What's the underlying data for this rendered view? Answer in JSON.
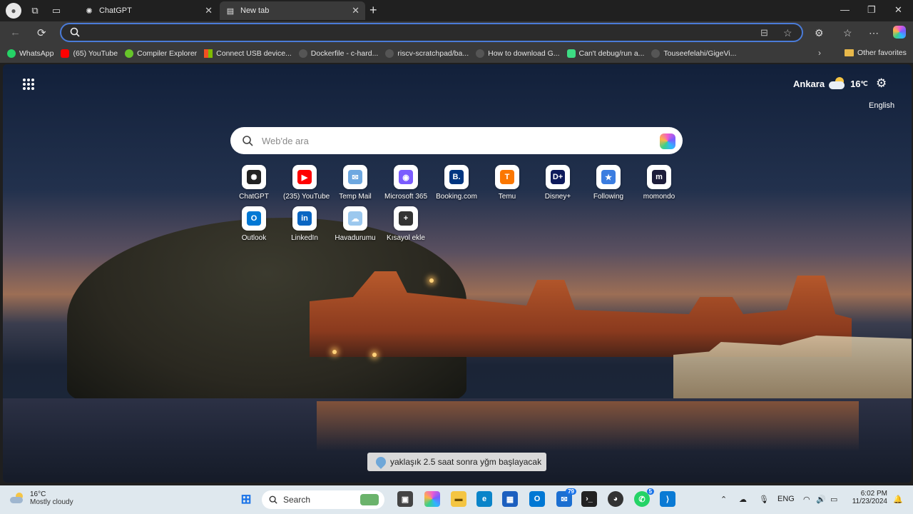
{
  "browser": {
    "tabs": [
      {
        "title": "ChatGPT",
        "active": false
      },
      {
        "title": "New tab",
        "active": true
      }
    ],
    "address_bar_value": "",
    "bookmarks": [
      {
        "label": "WhatsApp",
        "color": "#25d366"
      },
      {
        "label": "(65) YouTube",
        "color": "#ff0000"
      },
      {
        "label": "Compiler Explorer",
        "color": "#67c52a"
      },
      {
        "label": "Connect USB device...",
        "color": "#f25022"
      },
      {
        "label": "Dockerfile - c-hard...",
        "color": "#555555"
      },
      {
        "label": "riscv-scratchpad/ba...",
        "color": "#555555"
      },
      {
        "label": "How to download G...",
        "color": "#555555"
      },
      {
        "label": "Can't debug/run a...",
        "color": "#3ddc84"
      },
      {
        "label": "Touseefelahi/GigeVi...",
        "color": "#555555"
      }
    ],
    "other_favorites": "Other favorites"
  },
  "newtab": {
    "weather": {
      "city": "Ankara",
      "temp": "16",
      "unit": "℃"
    },
    "language": "English",
    "search_placeholder": "Web'de ara",
    "shortcuts": [
      {
        "label": "ChatGPT",
        "icon": "chatgpt-icon",
        "glyph": "✺",
        "color": "#222222"
      },
      {
        "label": "(235) YouTube",
        "icon": "youtube-icon",
        "glyph": "▶",
        "color": "#ff0000"
      },
      {
        "label": "Temp Mail",
        "icon": "mail-icon",
        "glyph": "✉",
        "color": "#6ea8e0"
      },
      {
        "label": "Microsoft 365",
        "icon": "m365-icon",
        "glyph": "◉",
        "color": "#7b5cff"
      },
      {
        "label": "Booking.com",
        "icon": "booking-icon",
        "glyph": "B.",
        "color": "#003580"
      },
      {
        "label": "Temu",
        "icon": "temu-icon",
        "glyph": "T",
        "color": "#fb7701"
      },
      {
        "label": "Disney+",
        "icon": "disney-icon",
        "glyph": "D+",
        "color": "#0e1a5b"
      },
      {
        "label": "Following",
        "icon": "following-icon",
        "glyph": "★",
        "color": "#3b7de0"
      },
      {
        "label": "momondo",
        "icon": "momondo-icon",
        "glyph": "m",
        "color": "#1d1d3a"
      },
      {
        "label": "Outlook",
        "icon": "outlook-icon",
        "glyph": "O",
        "color": "#0078d4"
      },
      {
        "label": "LinkedIn",
        "icon": "linkedin-icon",
        "glyph": "in",
        "color": "#0a66c2"
      },
      {
        "label": "Havadurumu",
        "icon": "weather-icon",
        "glyph": "☁",
        "color": "#9cc8ee"
      },
      {
        "label": "Kısayol ekle",
        "icon": "add-icon",
        "glyph": "+",
        "color": "#333333"
      }
    ],
    "toast": "yaklaşık 2.5 saat sonra yğm başlayacak"
  },
  "taskbar": {
    "weather_temp": "16°C",
    "weather_desc": "Mostly cloudy",
    "search_label": "Search",
    "lang": "ENG",
    "time": "6:02 PM",
    "date": "11/23/2024",
    "badge_a": "79",
    "badge_b": "5"
  }
}
